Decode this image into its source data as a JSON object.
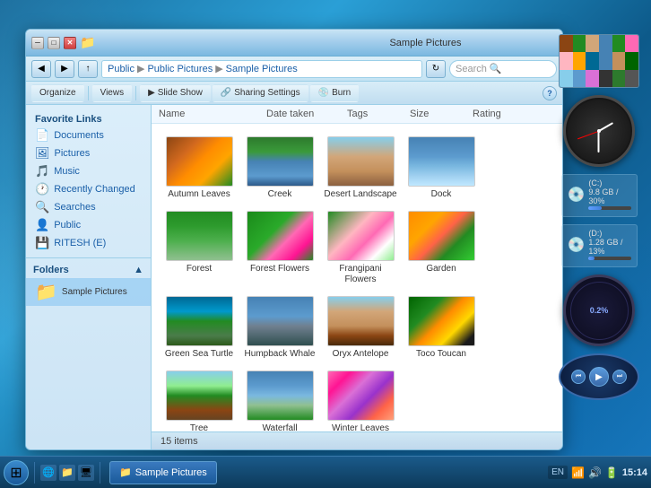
{
  "window": {
    "title": "Sample Pictures",
    "address": {
      "parts": [
        "Public",
        "Public Pictures",
        "Sample Pictures"
      ]
    },
    "search_placeholder": "Search"
  },
  "toolbar": {
    "organize": "Organize",
    "views": "Views",
    "slideshow": "Slide Show",
    "sharing": "Sharing Settings",
    "burn": "Burn"
  },
  "columns": {
    "name": "Name",
    "date": "Date taken",
    "tags": "Tags",
    "size": "Size",
    "rating": "Rating"
  },
  "sidebar": {
    "favorite_links_label": "Favorite Links",
    "items": [
      {
        "id": "documents",
        "label": "Documents",
        "icon": "📄"
      },
      {
        "id": "pictures",
        "label": "Pictures",
        "icon": "🖼"
      },
      {
        "id": "music",
        "label": "Music",
        "icon": "🎵"
      },
      {
        "id": "recently-changed",
        "label": "Recently Changed",
        "icon": "🕐"
      },
      {
        "id": "searches",
        "label": "Searches",
        "icon": "🔍"
      },
      {
        "id": "public",
        "label": "Public",
        "icon": "👤"
      },
      {
        "id": "ritesh-e",
        "label": "RITESH (E)",
        "icon": "💾"
      }
    ],
    "folders_label": "Folders",
    "folder_item": {
      "icon": "📁",
      "label": "Sample Pictures"
    }
  },
  "files": [
    {
      "id": "autumn-leaves",
      "label": "Autumn Leaves",
      "cls": "img-autumn"
    },
    {
      "id": "creek",
      "label": "Creek",
      "cls": "img-creek"
    },
    {
      "id": "desert-landscape",
      "label": "Desert Landscape",
      "cls": "img-desert"
    },
    {
      "id": "dock",
      "label": "Dock",
      "cls": "img-dock"
    },
    {
      "id": "forest",
      "label": "Forest",
      "cls": "img-forest"
    },
    {
      "id": "forest-flowers",
      "label": "Forest Flowers",
      "cls": "img-forest-flowers"
    },
    {
      "id": "frangipani-flowers",
      "label": "Frangipani Flowers",
      "cls": "img-frangipani"
    },
    {
      "id": "garden",
      "label": "Garden",
      "cls": "img-garden"
    },
    {
      "id": "green-sea-turtle",
      "label": "Green Sea Turtle",
      "cls": "img-turtle"
    },
    {
      "id": "humpback-whale",
      "label": "Humpback Whale",
      "cls": "img-whale"
    },
    {
      "id": "oryx-antelope",
      "label": "Oryx Antelope",
      "cls": "img-oryx"
    },
    {
      "id": "toco-toucan",
      "label": "Toco Toucan",
      "cls": "img-toucan"
    },
    {
      "id": "tree",
      "label": "Tree",
      "cls": "img-tree"
    },
    {
      "id": "waterfall",
      "label": "Waterfall",
      "cls": "img-waterfall"
    },
    {
      "id": "winter-leaves",
      "label": "Winter Leaves",
      "cls": "img-winter"
    }
  ],
  "status": {
    "count": "15 items"
  },
  "drives": [
    {
      "id": "c",
      "label": "(C:)",
      "sub": "9.8 GB / 30%",
      "fill": 30
    },
    {
      "id": "d",
      "label": "(D:)",
      "sub": "1.28 GB / 13%",
      "fill": 13
    }
  ],
  "taskbar": {
    "clock": "15:14",
    "lang": "EN",
    "taskbar_item": "Sample Pictures"
  }
}
